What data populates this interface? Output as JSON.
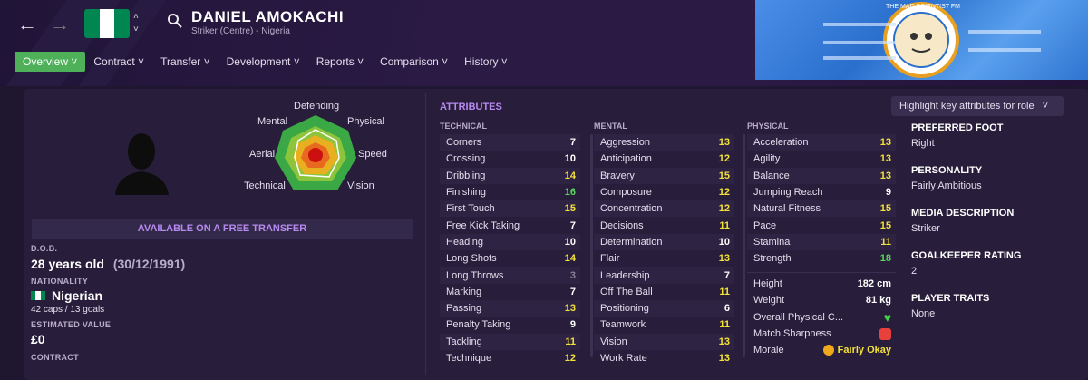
{
  "header": {
    "name": "DANIEL AMOKACHI",
    "subtitle": "Striker (Centre) - Nigeria",
    "flag_colors": [
      "#008751",
      "#ffffff",
      "#008751"
    ]
  },
  "nav": [
    {
      "label": "Overview",
      "active": true
    },
    {
      "label": "Contract"
    },
    {
      "label": "Transfer"
    },
    {
      "label": "Development"
    },
    {
      "label": "Reports"
    },
    {
      "label": "Comparison"
    },
    {
      "label": "History"
    }
  ],
  "banner_text": "THE MAD SCIENTIST FM",
  "radar": {
    "labels": [
      "Defending",
      "Physical",
      "Speed",
      "Vision",
      "Technical",
      "Aerial",
      "Mental"
    ]
  },
  "profile": {
    "available": "AVAILABLE ON A FREE TRANSFER",
    "dob_label": "D.O.B.",
    "dob_value": "28 years old",
    "dob_date": "(30/12/1991)",
    "nationality_label": "NATIONALITY",
    "nationality_value": "Nigerian",
    "caps": "42 caps / 13 goals",
    "value_label": "ESTIMATED VALUE",
    "value": "£0",
    "contract_label": "CONTRACT"
  },
  "attributes": {
    "title": "ATTRIBUTES",
    "highlight_button": "Highlight key attributes for role",
    "technical_label": "TECHNICAL",
    "mental_label": "MENTAL",
    "physical_label": "PHYSICAL",
    "technical": [
      {
        "name": "Corners",
        "value": "7"
      },
      {
        "name": "Crossing",
        "value": "10"
      },
      {
        "name": "Dribbling",
        "value": "14"
      },
      {
        "name": "Finishing",
        "value": "16"
      },
      {
        "name": "First Touch",
        "value": "15"
      },
      {
        "name": "Free Kick Taking",
        "value": "7"
      },
      {
        "name": "Heading",
        "value": "10"
      },
      {
        "name": "Long Shots",
        "value": "14"
      },
      {
        "name": "Long Throws",
        "value": "3"
      },
      {
        "name": "Marking",
        "value": "7"
      },
      {
        "name": "Passing",
        "value": "13"
      },
      {
        "name": "Penalty Taking",
        "value": "9"
      },
      {
        "name": "Tackling",
        "value": "11"
      },
      {
        "name": "Technique",
        "value": "12"
      }
    ],
    "mental": [
      {
        "name": "Aggression",
        "value": "13"
      },
      {
        "name": "Anticipation",
        "value": "12"
      },
      {
        "name": "Bravery",
        "value": "15"
      },
      {
        "name": "Composure",
        "value": "12"
      },
      {
        "name": "Concentration",
        "value": "12"
      },
      {
        "name": "Decisions",
        "value": "11"
      },
      {
        "name": "Determination",
        "value": "10"
      },
      {
        "name": "Flair",
        "value": "13"
      },
      {
        "name": "Leadership",
        "value": "7"
      },
      {
        "name": "Off The Ball",
        "value": "11"
      },
      {
        "name": "Positioning",
        "value": "6"
      },
      {
        "name": "Teamwork",
        "value": "11"
      },
      {
        "name": "Vision",
        "value": "13"
      },
      {
        "name": "Work Rate",
        "value": "13"
      }
    ],
    "physical": [
      {
        "name": "Acceleration",
        "value": "13"
      },
      {
        "name": "Agility",
        "value": "13"
      },
      {
        "name": "Balance",
        "value": "13"
      },
      {
        "name": "Jumping Reach",
        "value": "9"
      },
      {
        "name": "Natural Fitness",
        "value": "15"
      },
      {
        "name": "Pace",
        "value": "15"
      },
      {
        "name": "Stamina",
        "value": "11"
      },
      {
        "name": "Strength",
        "value": "18"
      }
    ],
    "physical_extra": [
      {
        "name": "Height",
        "value": "182 cm"
      },
      {
        "name": "Weight",
        "value": "81 kg"
      },
      {
        "name": "Overall Physical C...",
        "value": ""
      },
      {
        "name": "Match Sharpness",
        "value": ""
      },
      {
        "name": "Morale",
        "value": "Fairly Okay"
      }
    ]
  },
  "right": {
    "foot_label": "PREFERRED FOOT",
    "foot": "Right",
    "personality_label": "PERSONALITY",
    "personality": "Fairly Ambitious",
    "media_label": "MEDIA DESCRIPTION",
    "media": "Striker",
    "gk_label": "GOALKEEPER RATING",
    "gk": "2",
    "traits_label": "PLAYER TRAITS",
    "traits": "None"
  }
}
